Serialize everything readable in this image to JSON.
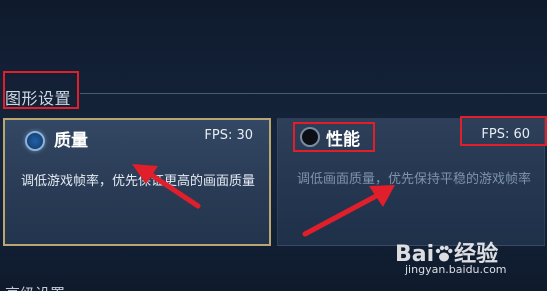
{
  "section": {
    "title": "图形设置",
    "next_title": "高级设置"
  },
  "options": {
    "quality": {
      "title": "质量",
      "fps": "FPS: 30",
      "description": "调低游戏帧率，优先保证更高的画面质量",
      "selected": true
    },
    "performance": {
      "title": "性能",
      "fps": "FPS: 60",
      "description": "调低画面质量，优先保持平稳的游戏帧率",
      "selected": false
    }
  },
  "colors": {
    "highlight": "#e01f2a",
    "selected_border": "#bba671",
    "radio_selected": "#1e60a9"
  },
  "watermark": {
    "logo_left": "Bai",
    "logo_right": "经验",
    "url": "jingyan.baidu.com"
  }
}
